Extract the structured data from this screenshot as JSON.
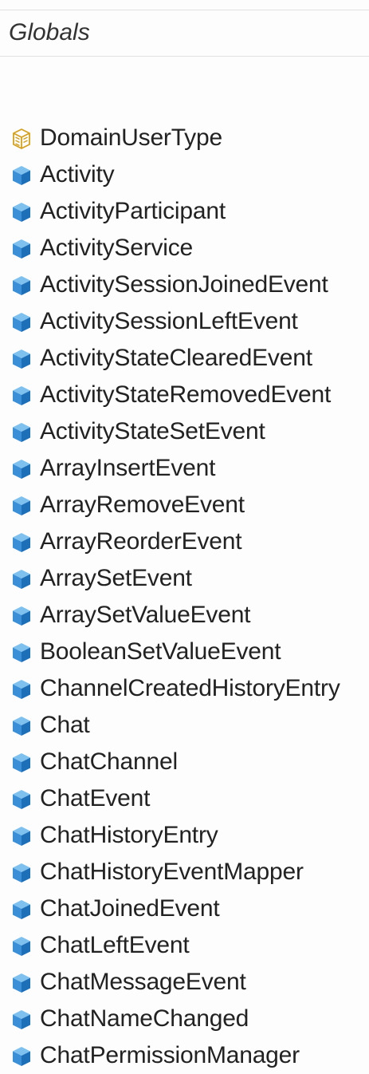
{
  "panel": {
    "title": "Globals"
  },
  "items": [
    {
      "label": "DomainUserType",
      "icon": "type-alias-icon"
    },
    {
      "label": "Activity",
      "icon": "class-icon"
    },
    {
      "label": "ActivityParticipant",
      "icon": "class-icon"
    },
    {
      "label": "ActivityService",
      "icon": "class-icon"
    },
    {
      "label": "ActivitySessionJoinedEvent",
      "icon": "class-icon"
    },
    {
      "label": "ActivitySessionLeftEvent",
      "icon": "class-icon"
    },
    {
      "label": "ActivityStateClearedEvent",
      "icon": "class-icon"
    },
    {
      "label": "ActivityStateRemovedEvent",
      "icon": "class-icon"
    },
    {
      "label": "ActivityStateSetEvent",
      "icon": "class-icon"
    },
    {
      "label": "ArrayInsertEvent",
      "icon": "class-icon"
    },
    {
      "label": "ArrayRemoveEvent",
      "icon": "class-icon"
    },
    {
      "label": "ArrayReorderEvent",
      "icon": "class-icon"
    },
    {
      "label": "ArraySetEvent",
      "icon": "class-icon"
    },
    {
      "label": "ArraySetValueEvent",
      "icon": "class-icon"
    },
    {
      "label": "BooleanSetValueEvent",
      "icon": "class-icon"
    },
    {
      "label": "ChannelCreatedHistoryEntry",
      "icon": "class-icon"
    },
    {
      "label": "Chat",
      "icon": "class-icon"
    },
    {
      "label": "ChatChannel",
      "icon": "class-icon"
    },
    {
      "label": "ChatEvent",
      "icon": "class-icon"
    },
    {
      "label": "ChatHistoryEntry",
      "icon": "class-icon"
    },
    {
      "label": "ChatHistoryEventMapper",
      "icon": "class-icon"
    },
    {
      "label": "ChatJoinedEvent",
      "icon": "class-icon"
    },
    {
      "label": "ChatLeftEvent",
      "icon": "class-icon"
    },
    {
      "label": "ChatMessageEvent",
      "icon": "class-icon"
    },
    {
      "label": "ChatNameChanged",
      "icon": "class-icon"
    },
    {
      "label": "ChatPermissionManager",
      "icon": "class-icon"
    }
  ],
  "colors": {
    "class_icon_top": "#7ec1ee",
    "class_icon_left": "#3a8fd6",
    "class_icon_right": "#1d6fb8",
    "type_alias_icon": "#d4a020"
  }
}
